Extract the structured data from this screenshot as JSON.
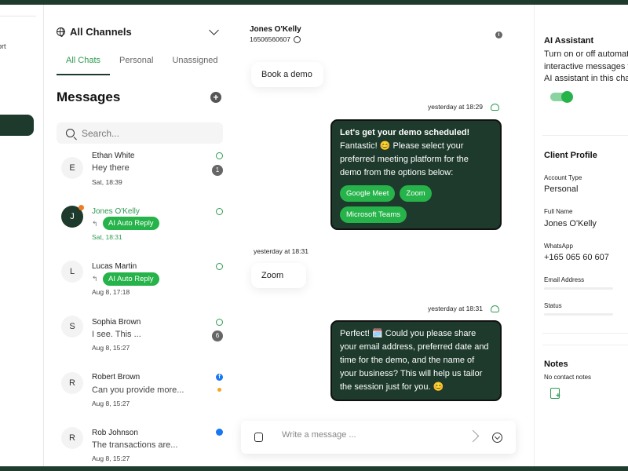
{
  "left_strip": {
    "cut_text": "ort"
  },
  "channels": {
    "title": "All Channels",
    "tabs": [
      {
        "label": "All Chats",
        "active": true
      },
      {
        "label": "Personal",
        "active": false
      },
      {
        "label": "Unassigned",
        "active": false
      }
    ],
    "section_title": "Messages",
    "search_placeholder": "Search...",
    "conversations": [
      {
        "initial": "E",
        "name": "Ethan White",
        "preview": "Hey there",
        "time": "Sat, 18:39",
        "channel": "whatsapp",
        "count": "1"
      },
      {
        "initial": "J",
        "name": "Jones O'Kelly",
        "badge": "AI Auto Reply",
        "time": "Sat, 18:31",
        "channel": "whatsapp",
        "active": true
      },
      {
        "initial": "L",
        "name": "Lucas Martin",
        "badge": "AI Auto Reply",
        "time": "Aug 8, 17:18",
        "channel": "whatsapp"
      },
      {
        "initial": "S",
        "name": "Sophia Brown",
        "preview": "I see. This ...",
        "time": "Aug 8, 15:27",
        "channel": "whatsapp",
        "count": "6"
      },
      {
        "initial": "R",
        "name": "Robert Brown",
        "preview": "Can you provide more...",
        "time": "Aug 8, 15:27",
        "channel": "facebook"
      },
      {
        "initial": "R",
        "name": "Rob Johnson",
        "preview": "The transactions are...",
        "time": "Aug 8, 15:27",
        "channel": "messenger"
      }
    ]
  },
  "chat": {
    "contact_name": "Jones O'Kelly",
    "contact_phone": "16506560607",
    "messages": {
      "m1": {
        "text": "Book a demo"
      },
      "ts1": "yesterday at 18:29",
      "m2": {
        "title": "Let's get your demo scheduled!",
        "body": "Fantastic! 😊 Please select your preferred meeting platform for the demo from the options below:",
        "chips": [
          "Google Meet",
          "Zoom",
          "Microsoft Teams"
        ]
      },
      "ts2": "yesterday at 18:31",
      "m3": {
        "text": "Zoom"
      },
      "ts3": "yesterday at 18:31",
      "m4": {
        "body": "Perfect! 🗓️ Could you please share your email address, preferred date and time for the demo, and the name of your business? This will help us tailor the session just for you. 😊"
      }
    },
    "composer_placeholder": "Write a message ..."
  },
  "right_panel": {
    "ai_title": "AI Assistant",
    "ai_text": "Turn on or off automated interactive messages from AI assistant in this chat.",
    "ai_enabled": true,
    "profile_title": "Client Profile",
    "fields": [
      {
        "label": "Account Type",
        "value": "Personal"
      },
      {
        "label": "Full Name",
        "value": "Jones O'Kelly"
      },
      {
        "label": "WhatsApp",
        "value": "+165 065 60 607"
      },
      {
        "label": "Email Address",
        "value": ""
      },
      {
        "label": "Status",
        "value": ""
      }
    ],
    "notes_title": "Notes",
    "notes_empty": "No contact notes"
  },
  "colors": {
    "brand_dark": "#1d3a2c",
    "accent_green": "#26b34a",
    "link_green": "#2f9a52"
  }
}
